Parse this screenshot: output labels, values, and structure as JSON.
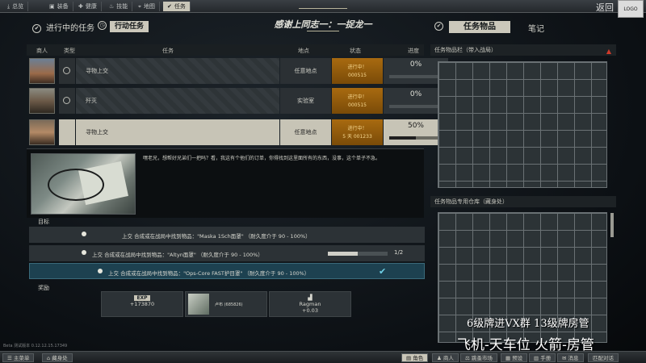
{
  "topnav": {
    "tabs": [
      {
        "label": "总览",
        "icon": "download-icon"
      },
      {
        "label": "装备",
        "icon": "gear-icon"
      },
      {
        "label": "健康",
        "icon": "health-icon"
      },
      {
        "label": "技能",
        "icon": "skill-icon"
      },
      {
        "label": "地图",
        "icon": "map-pin-icon"
      },
      {
        "label": "任务",
        "icon": "checkmark-icon"
      }
    ],
    "back_label": "返回",
    "logo_label": "LOGO"
  },
  "header": {
    "in_progress_label": "进行中的任务",
    "active_button": "行动任务",
    "title": "感谢上同志一：一捉龙一",
    "items_button": "任务物品",
    "notes_label": "笔记"
  },
  "table": {
    "columns": [
      "商人",
      "类型",
      "任务",
      "地点",
      "状态",
      "进度"
    ],
    "rows": [
      {
        "name": "寻物上交",
        "location": "任意地点",
        "status": "进行中！",
        "status2": "000515",
        "progress": "0%",
        "fill": 0
      },
      {
        "name": "歼灭",
        "location": "实验室",
        "status": "进行中！",
        "status2": "000515",
        "progress": "0%",
        "fill": 0
      },
      {
        "name": "寻物上交",
        "location": "任意地点",
        "status": "进行中！",
        "status2": "5 天 001233",
        "progress": "50%",
        "fill": 0.5
      }
    ]
  },
  "detail": {
    "description": "嘿老兄，想帮好兄弟们一把吗？看，我这有个他们的订单，你得找到这里面所有的东西，没事，这个单子不急。"
  },
  "goals": {
    "label": "目标",
    "items": [
      {
        "text": "上交 合成或在战局中找到物品：\"Maska 1Sch面罩\" （耐久度介于 90 - 100%）"
      },
      {
        "text": "上交 合成或在战局中找到物品：\"Altyn面罩\" （耐久度介于 90 - 100%）",
        "count": "1/2"
      },
      {
        "text": "上交 合成或在战局中找到物品：\"Ops-Core FAST护目罩\" （耐久度介于 90 - 100%）"
      }
    ]
  },
  "rewards": {
    "label": "奖励",
    "exp_badge": "EXP",
    "exp_value": "+173870",
    "item_text": "卢布 (685826)",
    "trader_name": "Ragman",
    "trader_value": "+0.03"
  },
  "panels": {
    "items_title": "任务物品栏（带入战局）",
    "stash_title": "任务物品专用仓库（藏身处）"
  },
  "overlay": {
    "line1": "6级牌进VX群  13级牌房管",
    "line2": "飞机-天车位  火箭-房管"
  },
  "beta_text": "Beta 测试版本 0.12.12.15.17349",
  "bottombar": {
    "left": [
      "主菜单",
      "藏身处"
    ],
    "right": [
      "角色",
      "商人",
      "跳蚤市场",
      "预设",
      "手册",
      "消息",
      "匹配对话"
    ]
  }
}
